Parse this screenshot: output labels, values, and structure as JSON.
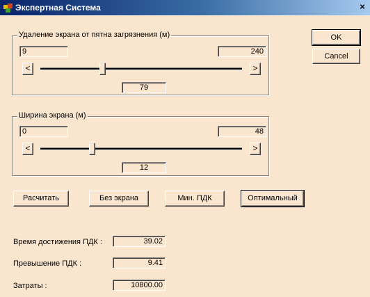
{
  "window": {
    "title": "Экспертная Система",
    "close_glyph": "×",
    "icon": "app-icon"
  },
  "dialog_buttons": {
    "ok": "OK",
    "cancel": "Cancel"
  },
  "distance_group": {
    "label": "Удаление экрана от пятна загрязнения (м)",
    "min": "9",
    "max": "240",
    "value": "79",
    "slider_fraction": 0.304
  },
  "width_group": {
    "label": "Ширина экрана (м)",
    "min": "0",
    "max": "48",
    "value": "12",
    "slider_fraction": 0.25
  },
  "scroll_arrows": {
    "left": "<",
    "right": ">"
  },
  "actions": {
    "calculate": "Расчитать",
    "no_screen": "Без экрана",
    "min_pdk": "Мин. ПДК",
    "optimal": "Оптимальный"
  },
  "results": {
    "time_label": "Время достижения ПДК :",
    "time_value": "39.02",
    "excess_label": "Превышение ПДК :",
    "excess_value": "9.41",
    "cost_label": "Затраты :",
    "cost_value": "10800.00"
  }
}
